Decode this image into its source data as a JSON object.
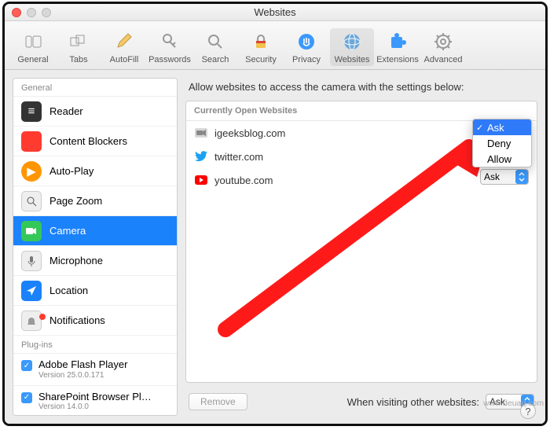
{
  "window": {
    "title": "Websites"
  },
  "toolbar": {
    "items": [
      {
        "id": "general",
        "label": "General"
      },
      {
        "id": "tabs",
        "label": "Tabs"
      },
      {
        "id": "autofill",
        "label": "AutoFill"
      },
      {
        "id": "passwords",
        "label": "Passwords"
      },
      {
        "id": "search",
        "label": "Search"
      },
      {
        "id": "security",
        "label": "Security"
      },
      {
        "id": "privacy",
        "label": "Privacy"
      },
      {
        "id": "websites",
        "label": "Websites"
      },
      {
        "id": "extensions",
        "label": "Extensions"
      },
      {
        "id": "advanced",
        "label": "Advanced"
      }
    ],
    "selected": "websites"
  },
  "sidebar": {
    "groups": [
      {
        "title": "General",
        "items": [
          {
            "id": "reader",
            "label": "Reader"
          },
          {
            "id": "content-blockers",
            "label": "Content Blockers"
          },
          {
            "id": "auto-play",
            "label": "Auto-Play"
          },
          {
            "id": "page-zoom",
            "label": "Page Zoom"
          },
          {
            "id": "camera",
            "label": "Camera"
          },
          {
            "id": "microphone",
            "label": "Microphone"
          },
          {
            "id": "location",
            "label": "Location"
          },
          {
            "id": "notifications",
            "label": "Notifications"
          }
        ],
        "selected": "camera"
      },
      {
        "title": "Plug-ins",
        "items": [
          {
            "id": "flash",
            "label": "Adobe Flash Player",
            "version": "Version 25.0.0.171",
            "checked": true
          },
          {
            "id": "sharepoint",
            "label": "SharePoint Browser Pl…",
            "version": "Version 14.0.0",
            "checked": true
          }
        ]
      }
    ]
  },
  "main": {
    "header": "Allow websites to access the camera with the settings below:",
    "section_title": "Currently Open Websites",
    "sites": [
      {
        "id": "igeeksblog",
        "domain": "igeeksblog.com",
        "permission": "Ask"
      },
      {
        "id": "twitter",
        "domain": "twitter.com",
        "permission": "Ask"
      },
      {
        "id": "youtube",
        "domain": "youtube.com",
        "permission": "Ask"
      }
    ],
    "dropdown": {
      "options": [
        "Ask",
        "Deny",
        "Allow"
      ],
      "selected": "Ask"
    },
    "remove_label": "Remove",
    "footer_label": "When visiting other websites:",
    "footer_value": "Ask"
  },
  "watermark": "www.deuaq.com"
}
